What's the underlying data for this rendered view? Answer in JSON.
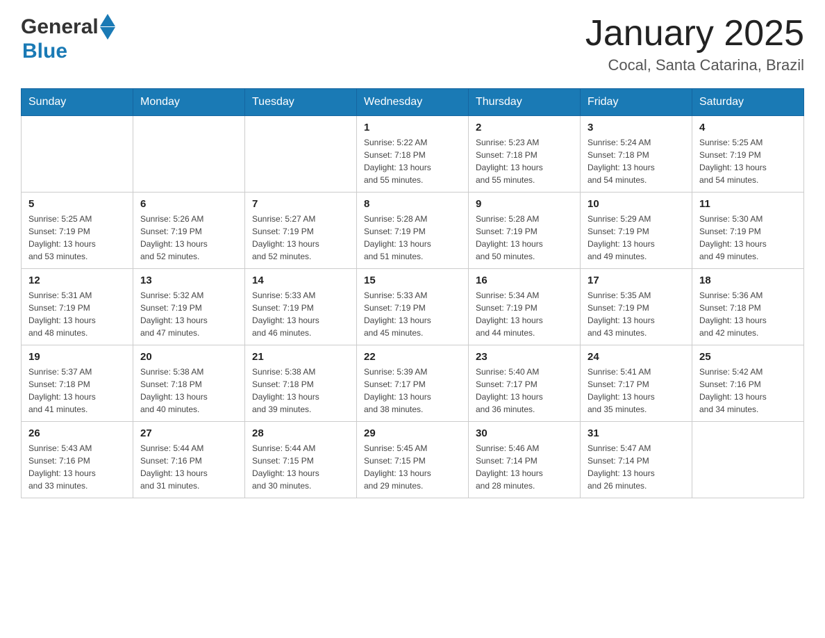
{
  "header": {
    "logo_general": "General",
    "logo_blue": "Blue",
    "main_title": "January 2025",
    "subtitle": "Cocal, Santa Catarina, Brazil"
  },
  "calendar": {
    "headers": [
      "Sunday",
      "Monday",
      "Tuesday",
      "Wednesday",
      "Thursday",
      "Friday",
      "Saturday"
    ],
    "weeks": [
      [
        {
          "day": "",
          "info": ""
        },
        {
          "day": "",
          "info": ""
        },
        {
          "day": "",
          "info": ""
        },
        {
          "day": "1",
          "info": "Sunrise: 5:22 AM\nSunset: 7:18 PM\nDaylight: 13 hours\nand 55 minutes."
        },
        {
          "day": "2",
          "info": "Sunrise: 5:23 AM\nSunset: 7:18 PM\nDaylight: 13 hours\nand 55 minutes."
        },
        {
          "day": "3",
          "info": "Sunrise: 5:24 AM\nSunset: 7:18 PM\nDaylight: 13 hours\nand 54 minutes."
        },
        {
          "day": "4",
          "info": "Sunrise: 5:25 AM\nSunset: 7:19 PM\nDaylight: 13 hours\nand 54 minutes."
        }
      ],
      [
        {
          "day": "5",
          "info": "Sunrise: 5:25 AM\nSunset: 7:19 PM\nDaylight: 13 hours\nand 53 minutes."
        },
        {
          "day": "6",
          "info": "Sunrise: 5:26 AM\nSunset: 7:19 PM\nDaylight: 13 hours\nand 52 minutes."
        },
        {
          "day": "7",
          "info": "Sunrise: 5:27 AM\nSunset: 7:19 PM\nDaylight: 13 hours\nand 52 minutes."
        },
        {
          "day": "8",
          "info": "Sunrise: 5:28 AM\nSunset: 7:19 PM\nDaylight: 13 hours\nand 51 minutes."
        },
        {
          "day": "9",
          "info": "Sunrise: 5:28 AM\nSunset: 7:19 PM\nDaylight: 13 hours\nand 50 minutes."
        },
        {
          "day": "10",
          "info": "Sunrise: 5:29 AM\nSunset: 7:19 PM\nDaylight: 13 hours\nand 49 minutes."
        },
        {
          "day": "11",
          "info": "Sunrise: 5:30 AM\nSunset: 7:19 PM\nDaylight: 13 hours\nand 49 minutes."
        }
      ],
      [
        {
          "day": "12",
          "info": "Sunrise: 5:31 AM\nSunset: 7:19 PM\nDaylight: 13 hours\nand 48 minutes."
        },
        {
          "day": "13",
          "info": "Sunrise: 5:32 AM\nSunset: 7:19 PM\nDaylight: 13 hours\nand 47 minutes."
        },
        {
          "day": "14",
          "info": "Sunrise: 5:33 AM\nSunset: 7:19 PM\nDaylight: 13 hours\nand 46 minutes."
        },
        {
          "day": "15",
          "info": "Sunrise: 5:33 AM\nSunset: 7:19 PM\nDaylight: 13 hours\nand 45 minutes."
        },
        {
          "day": "16",
          "info": "Sunrise: 5:34 AM\nSunset: 7:19 PM\nDaylight: 13 hours\nand 44 minutes."
        },
        {
          "day": "17",
          "info": "Sunrise: 5:35 AM\nSunset: 7:19 PM\nDaylight: 13 hours\nand 43 minutes."
        },
        {
          "day": "18",
          "info": "Sunrise: 5:36 AM\nSunset: 7:18 PM\nDaylight: 13 hours\nand 42 minutes."
        }
      ],
      [
        {
          "day": "19",
          "info": "Sunrise: 5:37 AM\nSunset: 7:18 PM\nDaylight: 13 hours\nand 41 minutes."
        },
        {
          "day": "20",
          "info": "Sunrise: 5:38 AM\nSunset: 7:18 PM\nDaylight: 13 hours\nand 40 minutes."
        },
        {
          "day": "21",
          "info": "Sunrise: 5:38 AM\nSunset: 7:18 PM\nDaylight: 13 hours\nand 39 minutes."
        },
        {
          "day": "22",
          "info": "Sunrise: 5:39 AM\nSunset: 7:17 PM\nDaylight: 13 hours\nand 38 minutes."
        },
        {
          "day": "23",
          "info": "Sunrise: 5:40 AM\nSunset: 7:17 PM\nDaylight: 13 hours\nand 36 minutes."
        },
        {
          "day": "24",
          "info": "Sunrise: 5:41 AM\nSunset: 7:17 PM\nDaylight: 13 hours\nand 35 minutes."
        },
        {
          "day": "25",
          "info": "Sunrise: 5:42 AM\nSunset: 7:16 PM\nDaylight: 13 hours\nand 34 minutes."
        }
      ],
      [
        {
          "day": "26",
          "info": "Sunrise: 5:43 AM\nSunset: 7:16 PM\nDaylight: 13 hours\nand 33 minutes."
        },
        {
          "day": "27",
          "info": "Sunrise: 5:44 AM\nSunset: 7:16 PM\nDaylight: 13 hours\nand 31 minutes."
        },
        {
          "day": "28",
          "info": "Sunrise: 5:44 AM\nSunset: 7:15 PM\nDaylight: 13 hours\nand 30 minutes."
        },
        {
          "day": "29",
          "info": "Sunrise: 5:45 AM\nSunset: 7:15 PM\nDaylight: 13 hours\nand 29 minutes."
        },
        {
          "day": "30",
          "info": "Sunrise: 5:46 AM\nSunset: 7:14 PM\nDaylight: 13 hours\nand 28 minutes."
        },
        {
          "day": "31",
          "info": "Sunrise: 5:47 AM\nSunset: 7:14 PM\nDaylight: 13 hours\nand 26 minutes."
        },
        {
          "day": "",
          "info": ""
        }
      ]
    ]
  }
}
